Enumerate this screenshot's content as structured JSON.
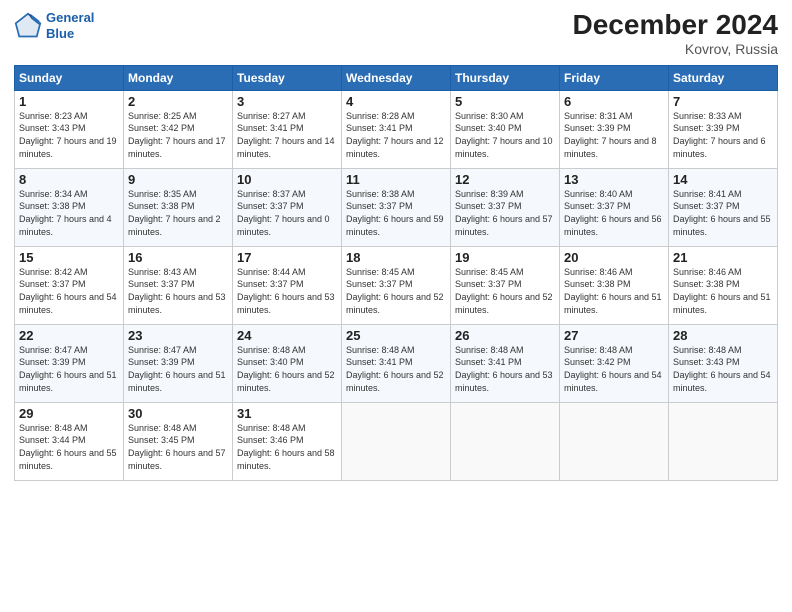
{
  "header": {
    "logo_line1": "General",
    "logo_line2": "Blue",
    "title": "December 2024",
    "subtitle": "Kovrov, Russia"
  },
  "weekdays": [
    "Sunday",
    "Monday",
    "Tuesday",
    "Wednesday",
    "Thursday",
    "Friday",
    "Saturday"
  ],
  "weeks": [
    [
      {
        "day": "1",
        "sunrise": "Sunrise: 8:23 AM",
        "sunset": "Sunset: 3:43 PM",
        "daylight": "Daylight: 7 hours and 19 minutes."
      },
      {
        "day": "2",
        "sunrise": "Sunrise: 8:25 AM",
        "sunset": "Sunset: 3:42 PM",
        "daylight": "Daylight: 7 hours and 17 minutes."
      },
      {
        "day": "3",
        "sunrise": "Sunrise: 8:27 AM",
        "sunset": "Sunset: 3:41 PM",
        "daylight": "Daylight: 7 hours and 14 minutes."
      },
      {
        "day": "4",
        "sunrise": "Sunrise: 8:28 AM",
        "sunset": "Sunset: 3:41 PM",
        "daylight": "Daylight: 7 hours and 12 minutes."
      },
      {
        "day": "5",
        "sunrise": "Sunrise: 8:30 AM",
        "sunset": "Sunset: 3:40 PM",
        "daylight": "Daylight: 7 hours and 10 minutes."
      },
      {
        "day": "6",
        "sunrise": "Sunrise: 8:31 AM",
        "sunset": "Sunset: 3:39 PM",
        "daylight": "Daylight: 7 hours and 8 minutes."
      },
      {
        "day": "7",
        "sunrise": "Sunrise: 8:33 AM",
        "sunset": "Sunset: 3:39 PM",
        "daylight": "Daylight: 7 hours and 6 minutes."
      }
    ],
    [
      {
        "day": "8",
        "sunrise": "Sunrise: 8:34 AM",
        "sunset": "Sunset: 3:38 PM",
        "daylight": "Daylight: 7 hours and 4 minutes."
      },
      {
        "day": "9",
        "sunrise": "Sunrise: 8:35 AM",
        "sunset": "Sunset: 3:38 PM",
        "daylight": "Daylight: 7 hours and 2 minutes."
      },
      {
        "day": "10",
        "sunrise": "Sunrise: 8:37 AM",
        "sunset": "Sunset: 3:37 PM",
        "daylight": "Daylight: 7 hours and 0 minutes."
      },
      {
        "day": "11",
        "sunrise": "Sunrise: 8:38 AM",
        "sunset": "Sunset: 3:37 PM",
        "daylight": "Daylight: 6 hours and 59 minutes."
      },
      {
        "day": "12",
        "sunrise": "Sunrise: 8:39 AM",
        "sunset": "Sunset: 3:37 PM",
        "daylight": "Daylight: 6 hours and 57 minutes."
      },
      {
        "day": "13",
        "sunrise": "Sunrise: 8:40 AM",
        "sunset": "Sunset: 3:37 PM",
        "daylight": "Daylight: 6 hours and 56 minutes."
      },
      {
        "day": "14",
        "sunrise": "Sunrise: 8:41 AM",
        "sunset": "Sunset: 3:37 PM",
        "daylight": "Daylight: 6 hours and 55 minutes."
      }
    ],
    [
      {
        "day": "15",
        "sunrise": "Sunrise: 8:42 AM",
        "sunset": "Sunset: 3:37 PM",
        "daylight": "Daylight: 6 hours and 54 minutes."
      },
      {
        "day": "16",
        "sunrise": "Sunrise: 8:43 AM",
        "sunset": "Sunset: 3:37 PM",
        "daylight": "Daylight: 6 hours and 53 minutes."
      },
      {
        "day": "17",
        "sunrise": "Sunrise: 8:44 AM",
        "sunset": "Sunset: 3:37 PM",
        "daylight": "Daylight: 6 hours and 53 minutes."
      },
      {
        "day": "18",
        "sunrise": "Sunrise: 8:45 AM",
        "sunset": "Sunset: 3:37 PM",
        "daylight": "Daylight: 6 hours and 52 minutes."
      },
      {
        "day": "19",
        "sunrise": "Sunrise: 8:45 AM",
        "sunset": "Sunset: 3:37 PM",
        "daylight": "Daylight: 6 hours and 52 minutes."
      },
      {
        "day": "20",
        "sunrise": "Sunrise: 8:46 AM",
        "sunset": "Sunset: 3:38 PM",
        "daylight": "Daylight: 6 hours and 51 minutes."
      },
      {
        "day": "21",
        "sunrise": "Sunrise: 8:46 AM",
        "sunset": "Sunset: 3:38 PM",
        "daylight": "Daylight: 6 hours and 51 minutes."
      }
    ],
    [
      {
        "day": "22",
        "sunrise": "Sunrise: 8:47 AM",
        "sunset": "Sunset: 3:39 PM",
        "daylight": "Daylight: 6 hours and 51 minutes."
      },
      {
        "day": "23",
        "sunrise": "Sunrise: 8:47 AM",
        "sunset": "Sunset: 3:39 PM",
        "daylight": "Daylight: 6 hours and 51 minutes."
      },
      {
        "day": "24",
        "sunrise": "Sunrise: 8:48 AM",
        "sunset": "Sunset: 3:40 PM",
        "daylight": "Daylight: 6 hours and 52 minutes."
      },
      {
        "day": "25",
        "sunrise": "Sunrise: 8:48 AM",
        "sunset": "Sunset: 3:41 PM",
        "daylight": "Daylight: 6 hours and 52 minutes."
      },
      {
        "day": "26",
        "sunrise": "Sunrise: 8:48 AM",
        "sunset": "Sunset: 3:41 PM",
        "daylight": "Daylight: 6 hours and 53 minutes."
      },
      {
        "day": "27",
        "sunrise": "Sunrise: 8:48 AM",
        "sunset": "Sunset: 3:42 PM",
        "daylight": "Daylight: 6 hours and 54 minutes."
      },
      {
        "day": "28",
        "sunrise": "Sunrise: 8:48 AM",
        "sunset": "Sunset: 3:43 PM",
        "daylight": "Daylight: 6 hours and 54 minutes."
      }
    ],
    [
      {
        "day": "29",
        "sunrise": "Sunrise: 8:48 AM",
        "sunset": "Sunset: 3:44 PM",
        "daylight": "Daylight: 6 hours and 55 minutes."
      },
      {
        "day": "30",
        "sunrise": "Sunrise: 8:48 AM",
        "sunset": "Sunset: 3:45 PM",
        "daylight": "Daylight: 6 hours and 57 minutes."
      },
      {
        "day": "31",
        "sunrise": "Sunrise: 8:48 AM",
        "sunset": "Sunset: 3:46 PM",
        "daylight": "Daylight: 6 hours and 58 minutes."
      },
      null,
      null,
      null,
      null
    ]
  ]
}
